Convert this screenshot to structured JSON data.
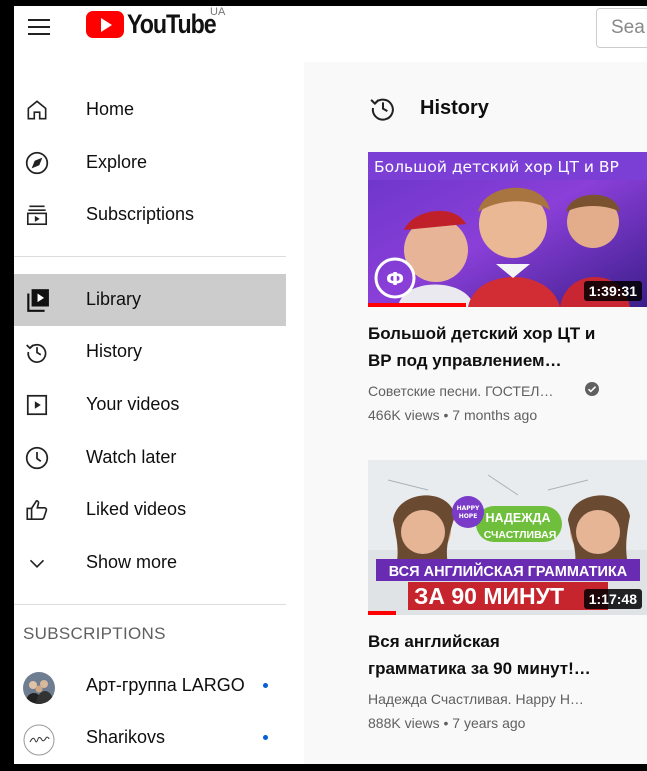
{
  "header": {
    "logo_text": "YouTube",
    "country_code": "UA",
    "search_placeholder": "Sea"
  },
  "sidebar": {
    "main_items": [
      {
        "label": "Home",
        "icon": "home-icon"
      },
      {
        "label": "Explore",
        "icon": "compass-icon"
      },
      {
        "label": "Subscriptions",
        "icon": "subscriptions-icon"
      }
    ],
    "library_items": [
      {
        "label": "Library",
        "icon": "library-icon",
        "active": true
      },
      {
        "label": "History",
        "icon": "history-icon"
      },
      {
        "label": "Your videos",
        "icon": "play-square-icon"
      },
      {
        "label": "Watch later",
        "icon": "clock-icon"
      },
      {
        "label": "Liked videos",
        "icon": "thumb-up-icon"
      },
      {
        "label": "Show more",
        "icon": "chevron-down-icon"
      }
    ],
    "subscriptions_title": "SUBSCRIPTIONS",
    "subscriptions": [
      {
        "label": "Арт-группа LARGO",
        "new_content": true
      },
      {
        "label": "Sharikovs",
        "new_content": true
      }
    ]
  },
  "main": {
    "section_title": "History",
    "videos": [
      {
        "thumb_caption": "Большой детский хор ЦТ и ВР",
        "duration": "1:39:31",
        "title_line1": "Большой детский хор ЦТ и",
        "title_line2": "ВР под управлением…",
        "channel": "Советские песни. ГОСТЕЛ…",
        "meta": "466K views • 7 months ago",
        "watched_fraction": 0.35
      },
      {
        "thumb_caption_1": "НАДЕЖДА",
        "thumb_caption_2": "СЧАСТЛИВАЯ",
        "thumb_caption_3": "ВСЯ АНГЛИЙСКАЯ ГРАММАТИКА",
        "thumb_caption_4": "ЗА 90 МИНУТ",
        "thumb_badge": "HAPPY HOPE",
        "duration": "1:17:48",
        "title_line1": "Вся английская",
        "title_line2": "грамматика за 90 минут!…",
        "channel": "Надежда Счастливая. Happy H…",
        "meta": "888K views • 7 years ago",
        "watched_fraction": 0.1
      }
    ]
  },
  "colors": {
    "brand_red": "#ff0000",
    "active_bg": "#cccccc",
    "new_dot": "#065fd4"
  }
}
